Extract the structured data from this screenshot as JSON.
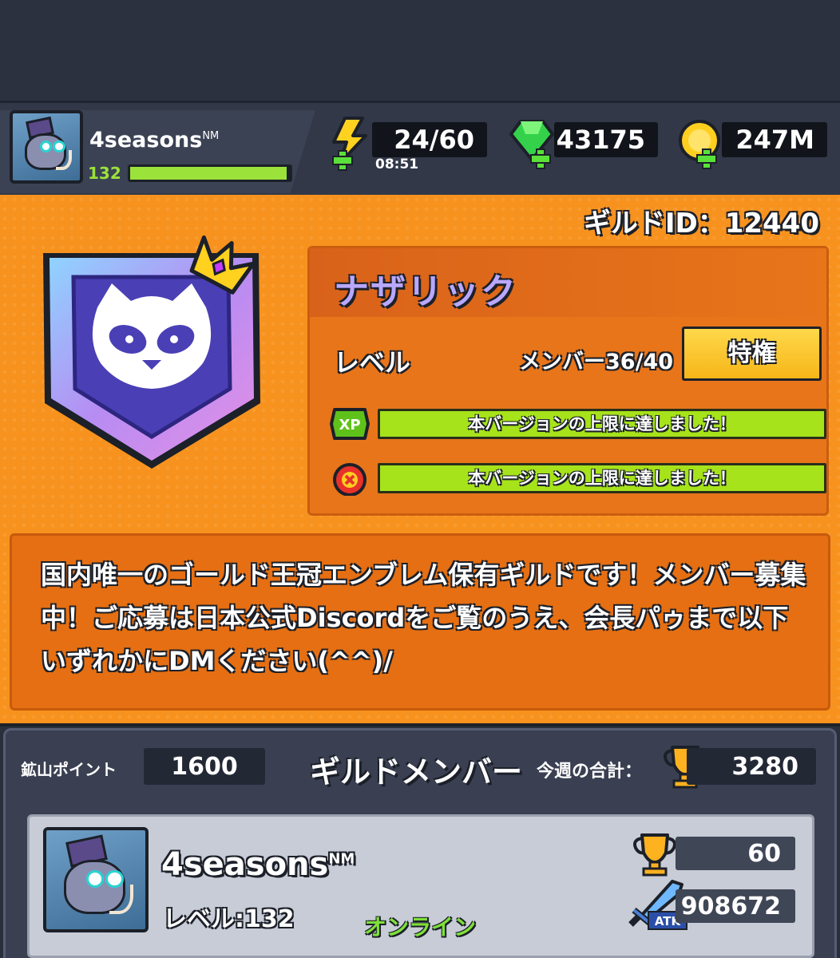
{
  "player": {
    "name": "4seasons",
    "badge": "NM",
    "level": "132",
    "xp_fraction": 0.98
  },
  "resources": {
    "energy": "24/60",
    "energy_timer": "08:51",
    "gems": "43175",
    "gold": "247M"
  },
  "guild": {
    "id_label": "ギルドID：12440",
    "name": "ナザリック",
    "level_label": "レベル",
    "members_label": "メンバー36/40",
    "perk_button": "特権",
    "xp_bar_text": "本バージョンの上限に達しました！",
    "coin_bar_text": "本バージョンの上限に達しました！",
    "xp_icon_text": "XP",
    "description": "国内唯一のゴールド王冠エンブレム保有ギルドです！メンバー募集中！ご応募は日本公式Discordをご覧のうえ、会長パゥまで以下いずれかにDMください(^^)/"
  },
  "members_section": {
    "mine_label": "鉱山ポイント",
    "mine_value": "1600",
    "title": "ギルドメンバー",
    "week_label": "今週の合計：",
    "week_total": "3280"
  },
  "member": {
    "name": "4seasons",
    "badge": "NM",
    "level": "レベル:132",
    "status": "オンライン",
    "trophies": "60",
    "atk": "908672",
    "atk_label": "ATK"
  },
  "colors": {
    "orange": "#f7921e",
    "green": "#a6e31a",
    "dark": "#2c3140",
    "gold": "#f6b619"
  }
}
